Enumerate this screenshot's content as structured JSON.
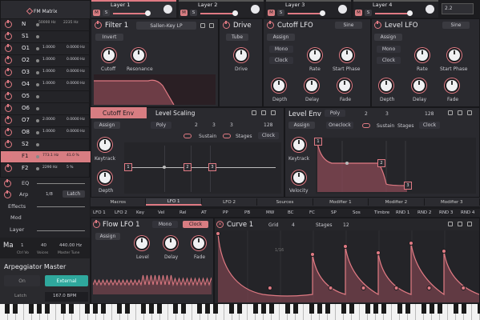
{
  "fm": {
    "title": "FM Matrix",
    "header_a": "50000 Hz",
    "header_b": "2235 Hz",
    "rows": [
      {
        "label": "N",
        "a": "",
        "b": ""
      },
      {
        "label": "S1",
        "a": "",
        "b": ""
      },
      {
        "label": "O1",
        "a": "1.0000",
        "b": "0.0000 Hz"
      },
      {
        "label": "O2",
        "a": "1.0000",
        "b": "0.0000 Hz"
      },
      {
        "label": "O3",
        "a": "1.0000",
        "b": "0.0000 Hz"
      },
      {
        "label": "O4",
        "a": "1.0000",
        "b": "0.0000 Hz"
      },
      {
        "label": "O5",
        "a": "",
        "b": ""
      },
      {
        "label": "O6",
        "a": "",
        "b": ""
      },
      {
        "label": "O7",
        "a": "2.0000",
        "b": "0.0000 Hz"
      },
      {
        "label": "O8",
        "a": "1.0000",
        "b": "0.0000 Hz"
      },
      {
        "label": "S2",
        "a": "",
        "b": ""
      },
      {
        "label": "F1",
        "a": "773.1 Hz",
        "b": "41.0 %"
      },
      {
        "label": "F2",
        "a": "2290 Hz",
        "b": "5 %"
      }
    ],
    "eq": "EQ",
    "arp": "Arp",
    "arp_rate": "1/8",
    "arp_latch": "Latch",
    "effects": "Effects",
    "mod": "Mod",
    "layer": "Layer",
    "ma": "Ma",
    "ma_vals": [
      "1",
      "40",
      "440.00 Hz"
    ],
    "ma_labels": [
      "Ctrl Vo",
      "Voices",
      "Master Tune"
    ]
  },
  "arpm": {
    "title": "Arpeggiator Master",
    "on": "On",
    "external": "External",
    "latch": "Latch",
    "bpm": "167.0 BPM"
  },
  "layers": {
    "tabs": [
      {
        "label": "Layer 1",
        "m": "M",
        "s": "S"
      },
      {
        "label": "Layer 2",
        "m": "M",
        "s": "S"
      },
      {
        "label": "Layer 3",
        "m": "M",
        "s": "S"
      },
      {
        "label": "Layer 4",
        "m": "M",
        "s": "S"
      }
    ],
    "readout": "2.2"
  },
  "filter1": {
    "title": "Filter 1",
    "type": "Sallen-Key LP",
    "invert": "Invert",
    "cutoff": "Cutoff",
    "resonance": "Resonance"
  },
  "drive": {
    "title": "Drive",
    "type": "Tube",
    "knob": "Drive"
  },
  "cutofflfo": {
    "title": "Cutoff LFO",
    "wave": "Sine",
    "assign": "Assign",
    "mono": "Mono",
    "clock": "Clock",
    "rate": "Rate",
    "start": "Start Phase",
    "depth": "Depth",
    "delay": "Delay",
    "fade": "Fade"
  },
  "levellfo": {
    "title": "Level LFO",
    "wave": "Sine",
    "assign": "Assign",
    "mono": "Mono",
    "clock": "Clock",
    "rate": "Rate",
    "start": "Start Phase",
    "depth": "Depth",
    "delay": "Delay",
    "fade": "Fade"
  },
  "cutoffenv": {
    "tab1": "Cutoff Env",
    "tab2": "Level Scaling",
    "assign": "Assign",
    "poly": "Poly",
    "n1": "2",
    "n2": "3",
    "n3": "3",
    "n4": "128",
    "sustain": "Sustain",
    "stages": "Stages",
    "clock": "Clock",
    "keytrack": "Keytrack",
    "depth": "Depth",
    "points": [
      "1",
      "2",
      "3"
    ]
  },
  "levelenv": {
    "title": "Level Env",
    "poly": "Poly",
    "n1": "2",
    "n2": "3",
    "n3": "128",
    "assign": "Assign",
    "oneclock": "Oneclock",
    "sustain": "Sustain",
    "stages": "Stages",
    "clock": "Clock",
    "keytrack": "Keytrack",
    "velocity": "Velocity",
    "points": [
      "1",
      "2",
      "3"
    ]
  },
  "modtabs": {
    "top": [
      "Macros",
      "LFO 1",
      "LFO 2",
      "Sources",
      "Modifier 1",
      "Modifier 2",
      "Modifier 3"
    ],
    "slots": [
      "LFO 1",
      "LFO 2",
      "Key",
      "Vel",
      "Rel",
      "AT",
      "PP",
      "PB",
      "MW",
      "BC",
      "FC",
      "SP",
      "Sos",
      "Timbre",
      "RND 1",
      "RND 2",
      "RND 3",
      "RND 4"
    ]
  },
  "flowlfo": {
    "title": "Flow LFO 1",
    "mono": "Mono",
    "clock": "Clock",
    "assign": "Assign",
    "level": "Level",
    "delay": "Delay",
    "fade": "Fade"
  },
  "curve": {
    "title": "Curve 1",
    "grid_label": "Grid",
    "grid": "4",
    "stages_label": "Stages",
    "stages": "12",
    "marker": "1/16"
  },
  "colors": {
    "accent": "#e07a83",
    "accent_fill": "#d87d82",
    "bg": "#1b1b1e",
    "panel": "#2a2a2f"
  }
}
